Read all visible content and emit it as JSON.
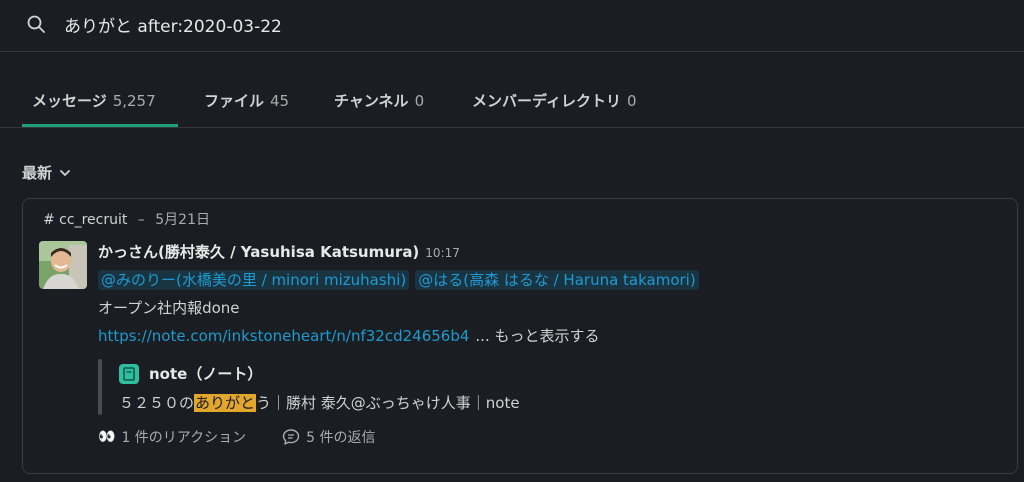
{
  "search": {
    "query": "ありがと after:2020-03-22"
  },
  "tabs": [
    {
      "label": "メッセージ",
      "count": "5,257"
    },
    {
      "label": "ファイル",
      "count": "45"
    },
    {
      "label": "チャンネル",
      "count": "0"
    },
    {
      "label": "メンバーディレクトリ",
      "count": "0"
    }
  ],
  "sort": {
    "label": "最新"
  },
  "result": {
    "channel": "# cc_recruit",
    "separator": "–",
    "date": "5月21日",
    "author": "かっさん(勝村泰久 / Yasuhisa Katsumura)",
    "time": "10:17",
    "mentions": [
      "@みのりー(水橋美の里 / minori mizuhashi)",
      "@はる(高森 はるな / Haruna takamori)"
    ],
    "body": "オープン社内報done",
    "link": "https://note.com/inkstoneheart/n/nf32cd24656b4",
    "more": "... もっと表示する",
    "unfurl": {
      "title": "note（ノート）",
      "desc_before": "５２５０の",
      "desc_highlight": "ありがと",
      "desc_after": "う｜勝村 泰久@ぶっちゃけ人事｜note"
    },
    "reactions": {
      "emoji": "👀",
      "label": "1 件のリアクション"
    },
    "replies": {
      "label": "5 件の返信"
    }
  },
  "colors": {
    "background": "#1a1d21",
    "accent_tab": "#1e9e7d",
    "link": "#1d9bd1",
    "highlight": "#e2a62c"
  }
}
